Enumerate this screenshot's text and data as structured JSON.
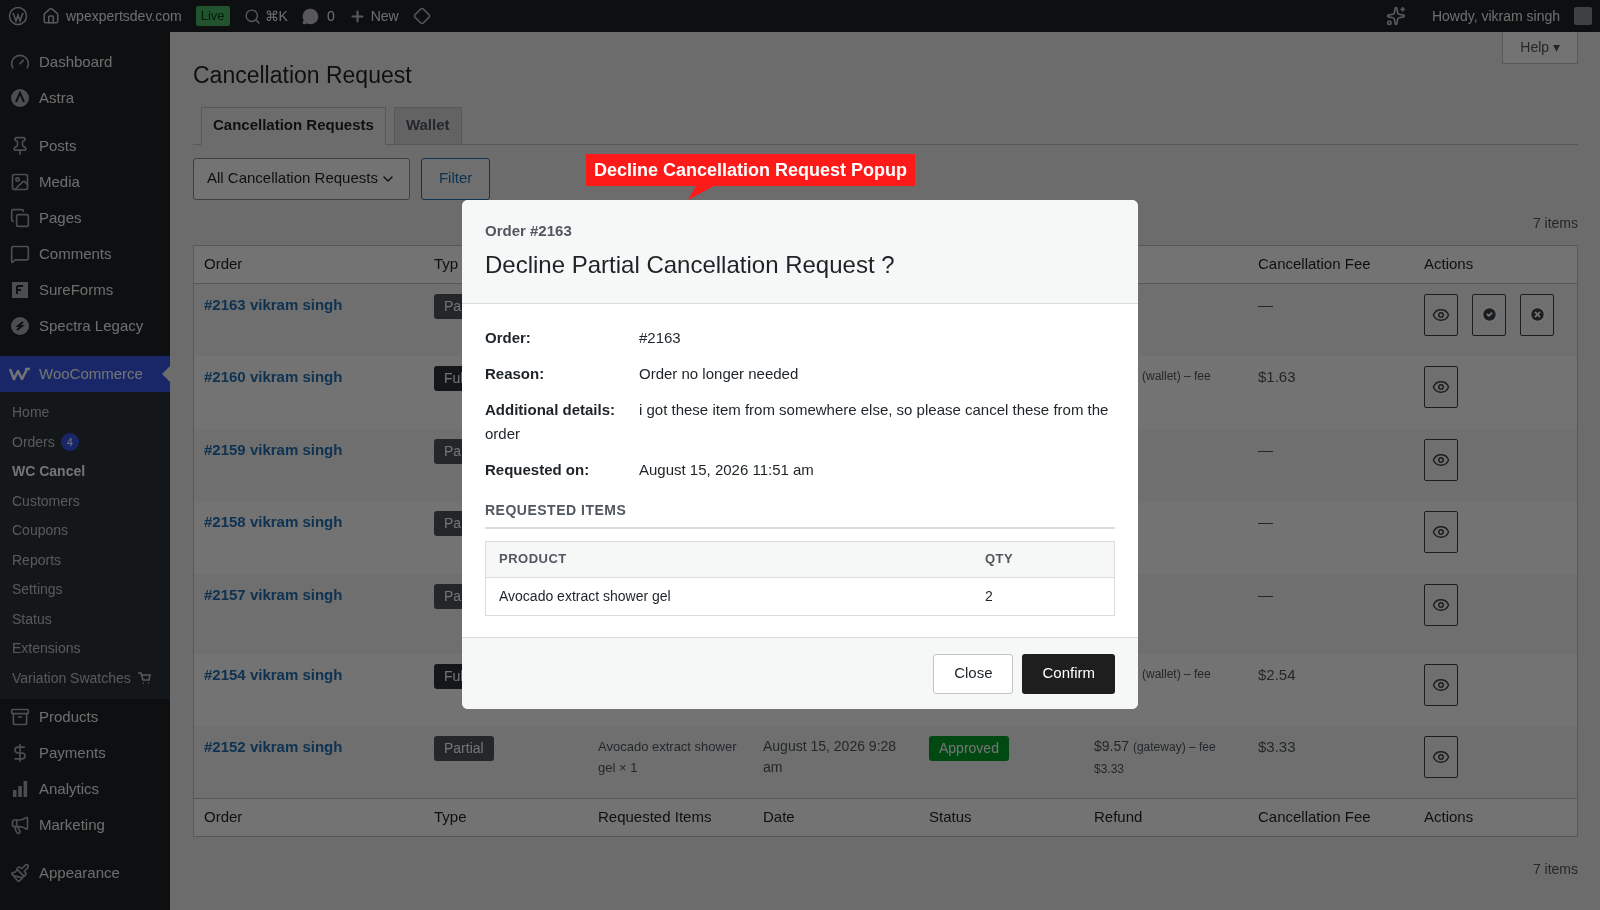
{
  "admin_bar": {
    "site": "wpexpertsdev.com",
    "env_badge": "Live",
    "search_shortcut": "⌘K",
    "comments": "0",
    "new": "New",
    "greeting": "Howdy, vikram singh"
  },
  "sidebar": {
    "groups": [
      [
        {
          "label": "Dashboard",
          "selected": false
        },
        {
          "label": "Astra",
          "selected": false
        }
      ],
      [
        {
          "label": "Posts",
          "selected": false
        },
        {
          "label": "Media",
          "selected": false
        },
        {
          "label": "Pages",
          "selected": false
        },
        {
          "label": "Comments",
          "selected": false
        },
        {
          "label": "SureForms",
          "selected": false
        },
        {
          "label": "Spectra Legacy",
          "selected": false
        }
      ],
      [
        {
          "label": "WooCommerce",
          "selected": true,
          "children": [
            {
              "label": "Home",
              "selected": false
            },
            {
              "label": "Orders",
              "selected": false,
              "badge": "4"
            },
            {
              "label": "WC Cancel",
              "selected": true
            },
            {
              "label": "Customers",
              "selected": false
            },
            {
              "label": "Coupons",
              "selected": false
            },
            {
              "label": "Reports",
              "selected": false
            },
            {
              "label": "Settings",
              "selected": false
            },
            {
              "label": "Status",
              "selected": false
            },
            {
              "label": "Extensions",
              "selected": false
            },
            {
              "label": "Variation Swatches",
              "selected": false
            }
          ]
        },
        {
          "label": "Products",
          "selected": false
        },
        {
          "label": "Payments",
          "selected": false
        },
        {
          "label": "Analytics",
          "selected": false
        },
        {
          "label": "Marketing",
          "selected": false
        }
      ],
      [
        {
          "label": "Appearance",
          "selected": false
        }
      ]
    ]
  },
  "help": "Help ▾",
  "page_title": "Cancellation Request",
  "tabs": [
    {
      "label": "Cancellation Requests",
      "selected": true
    },
    {
      "label": "Wallet",
      "selected": false
    }
  ],
  "filter": {
    "select": "All Cancellation Requests",
    "button": "Filter"
  },
  "item_count_top": "7 items",
  "table": {
    "columns_top": [
      "Order",
      "Typ",
      "Cancellation Fee",
      "Actions"
    ],
    "rows": [
      {
        "order": "#2163 vikram singh",
        "type": {
          "label": "Pa",
          "kind": "partial"
        },
        "fee": "—",
        "actions": [
          {
            "kind": "view"
          },
          {
            "kind": "approve"
          },
          {
            "kind": "decline"
          }
        ]
      },
      {
        "order": "#2160 vikram singh",
        "type": {
          "label": "Ful",
          "kind": "full"
        },
        "refund": {
          "note": "(wallet) – fee"
        },
        "fee": "$1.63",
        "actions": [
          {
            "kind": "view"
          }
        ]
      },
      {
        "order": "#2159 vikram singh",
        "type": {
          "label": "Pa",
          "kind": "partial"
        },
        "fee": "—",
        "actions": [
          {
            "kind": "view"
          }
        ]
      },
      {
        "order": "#2158 vikram singh",
        "type": {
          "label": "Pa",
          "kind": "partial"
        },
        "fee": "—",
        "actions": [
          {
            "kind": "view"
          }
        ]
      },
      {
        "order": "#2157 vikram singh",
        "type": {
          "label": "Pa",
          "kind": "partial"
        },
        "fee": "—",
        "actions": [
          {
            "kind": "view"
          }
        ]
      },
      {
        "order": "#2154 vikram singh",
        "type": {
          "label": "Ful",
          "kind": "full"
        },
        "refund": {
          "note": "(wallet) – fee"
        },
        "fee": "$2.54",
        "actions": [
          {
            "kind": "view"
          }
        ]
      },
      {
        "order": "#2152 vikram singh",
        "type": {
          "label": "Partial",
          "kind": "partial"
        },
        "items": "Avocado extract shower gel × 1",
        "date": "August 15, 2026 9:28 am",
        "status": {
          "label": "Approved",
          "kind": "approved"
        },
        "refund": {
          "amount": "$9.57",
          "note": "(gateway) – fee",
          "fee_amount": "$3.33"
        },
        "fee": "$3.33",
        "actions": [
          {
            "kind": "view"
          }
        ]
      }
    ],
    "columns_bottom": [
      "Order",
      "Type",
      "Requested Items",
      "Date",
      "Status",
      "Refund",
      "Cancellation Fee",
      "Actions"
    ]
  },
  "item_count_bottom": "7 items",
  "annotation": "Decline Cancellation Request Popup",
  "modal": {
    "order_label": "Order #2163",
    "title": "Decline Partial Cancellation Request ?",
    "details": [
      {
        "label": "Order:",
        "value": "#2163"
      },
      {
        "label": "Reason:",
        "value": "Order no longer needed"
      },
      {
        "label": "Additional details:",
        "value": "i got these item from somewhere else, so please cancel these from the order"
      },
      {
        "label": "Requested on:",
        "value": "August 15, 2026 11:51 am"
      }
    ],
    "section_title": "REQUESTED ITEMS",
    "items_table": {
      "columns": [
        "PRODUCT",
        "QTY"
      ],
      "rows": [
        [
          "Avocado extract shower gel",
          "2"
        ]
      ]
    },
    "buttons": [
      {
        "label": "Close",
        "kind": "secondary"
      },
      {
        "label": "Confirm",
        "kind": "primary"
      }
    ]
  }
}
